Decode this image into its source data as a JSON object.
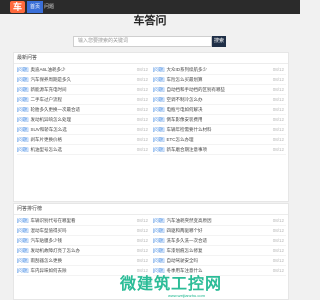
{
  "header": {
    "logo_text": "车",
    "nav_home": "首页",
    "nav_qa": "问题"
  },
  "brand": {
    "title": "车答问"
  },
  "search": {
    "placeholder": "输入您要搜索的关键词",
    "button": "搜索"
  },
  "panel_latest": {
    "title": "最新问答",
    "left": [
      {
        "tag": "[问题]",
        "title": "奥迪A6L油耗多少",
        "date": "08/12"
      },
      {
        "tag": "[问题]",
        "title": "汽车保养周期是多久",
        "date": "08/12"
      },
      {
        "tag": "[问题]",
        "title": "新能源车充电时间",
        "date": "08/12"
      },
      {
        "tag": "[问题]",
        "title": "二手车过户流程",
        "date": "08/12"
      },
      {
        "tag": "[问题]",
        "title": "轮胎多久更换一次最合适",
        "date": "08/12"
      },
      {
        "tag": "[问题]",
        "title": "发动机异响怎么处理",
        "date": "08/12"
      },
      {
        "tag": "[问题]",
        "title": "SUV和轿车怎么选",
        "date": "08/12"
      },
      {
        "tag": "[问题]",
        "title": "刹车片更换价格",
        "date": "08/12"
      },
      {
        "tag": "[问题]",
        "title": "机油型号怎么选",
        "date": "08/12"
      }
    ],
    "right": [
      {
        "tag": "[问题]",
        "title": "大众ID系列续航多少",
        "date": "08/12"
      },
      {
        "tag": "[问题]",
        "title": "车险怎么买最划算",
        "date": "08/12"
      },
      {
        "tag": "[问题]",
        "title": "自动挡和手动挡的区别有哪些",
        "date": "08/12"
      },
      {
        "tag": "[问题]",
        "title": "空调不制冷怎么办",
        "date": "08/12"
      },
      {
        "tag": "[问题]",
        "title": "电瓶亏电如何解决",
        "date": "08/12"
      },
      {
        "tag": "[问题]",
        "title": "倒车影像安装费用",
        "date": "08/12"
      },
      {
        "tag": "[问题]",
        "title": "车辆年检需要什么材料",
        "date": "08/12"
      },
      {
        "tag": "[问题]",
        "title": "ETC怎么办理",
        "date": "08/12"
      },
      {
        "tag": "[问题]",
        "title": "新车磨合期注意事项",
        "date": "08/12"
      }
    ]
  },
  "panel_hot": {
    "title": "问答排行榜",
    "left": [
      {
        "tag": "[问题]",
        "title": "车辆识别代号在哪里看",
        "date": "08/12"
      },
      {
        "tag": "[问题]",
        "title": "混动车型值得买吗",
        "date": "08/12"
      },
      {
        "tag": "[问题]",
        "title": "汽车贴膜多少钱",
        "date": "08/12"
      },
      {
        "tag": "[问题]",
        "title": "发动机故障灯亮了怎么办",
        "date": "08/12"
      },
      {
        "tag": "[问题]",
        "title": "雨刮器怎么更换",
        "date": "08/12"
      },
      {
        "tag": "[问题]",
        "title": "车内异味如何去除",
        "date": "08/12"
      }
    ],
    "right": [
      {
        "tag": "[问题]",
        "title": "汽车油耗突然变高原因",
        "date": "08/12"
      },
      {
        "tag": "[问题]",
        "title": "四驱和两驱哪个好",
        "date": "08/12"
      },
      {
        "tag": "[问题]",
        "title": "洗车多久洗一次合适",
        "date": "08/12"
      },
      {
        "tag": "[问题]",
        "title": "车漆划痕怎么修复",
        "date": "08/12"
      },
      {
        "tag": "[问题]",
        "title": "自动驾驶安全吗",
        "date": "08/12"
      },
      {
        "tag": "[问题]",
        "title": "冬季用车注意什么",
        "date": "08/12"
      }
    ]
  },
  "watermark": {
    "text": "微建筑工控网",
    "sub": "www.weijianzhu.com"
  }
}
